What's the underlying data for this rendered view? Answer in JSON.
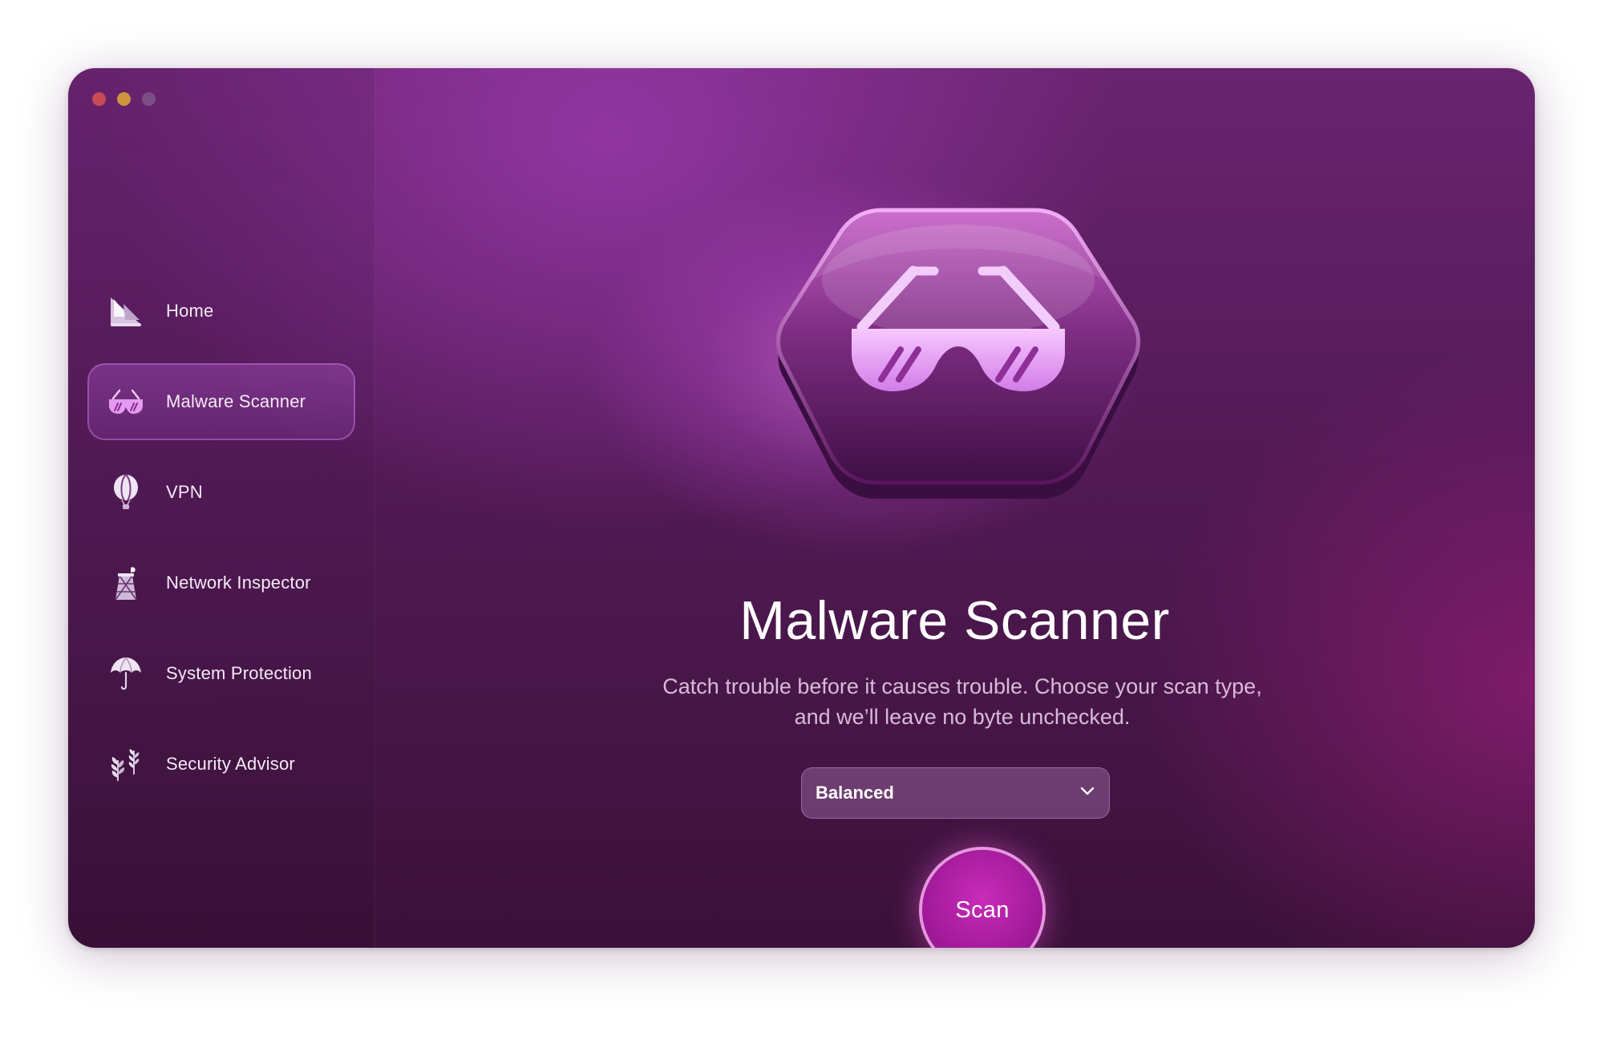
{
  "window": {
    "controls": [
      "close",
      "minimize",
      "zoom"
    ]
  },
  "sidebar": {
    "items": [
      {
        "label": "Home",
        "icon": "home-icon",
        "active": false
      },
      {
        "label": "Malware Scanner",
        "icon": "glasses-icon",
        "active": true
      },
      {
        "label": "VPN",
        "icon": "balloon-icon",
        "active": false
      },
      {
        "label": "Network Inspector",
        "icon": "tower-icon",
        "active": false
      },
      {
        "label": "System Protection",
        "icon": "umbrella-icon",
        "active": false
      },
      {
        "label": "Security Advisor",
        "icon": "plants-icon",
        "active": false
      }
    ]
  },
  "main": {
    "hero_icon": "glasses-icon",
    "title": "Malware Scanner",
    "subtitle_line1": "Catch trouble before it causes trouble. Choose your scan type,",
    "subtitle_line2": "and we’ll leave no byte unchecked.",
    "scan_type": {
      "selected": "Balanced"
    },
    "scan_button": "Scan"
  },
  "colors": {
    "accent": "#b21fa8",
    "background_top": "#6a2470",
    "background_bottom": "#3b1139",
    "close": "#ec5a53",
    "minimize": "#f3bd31"
  }
}
